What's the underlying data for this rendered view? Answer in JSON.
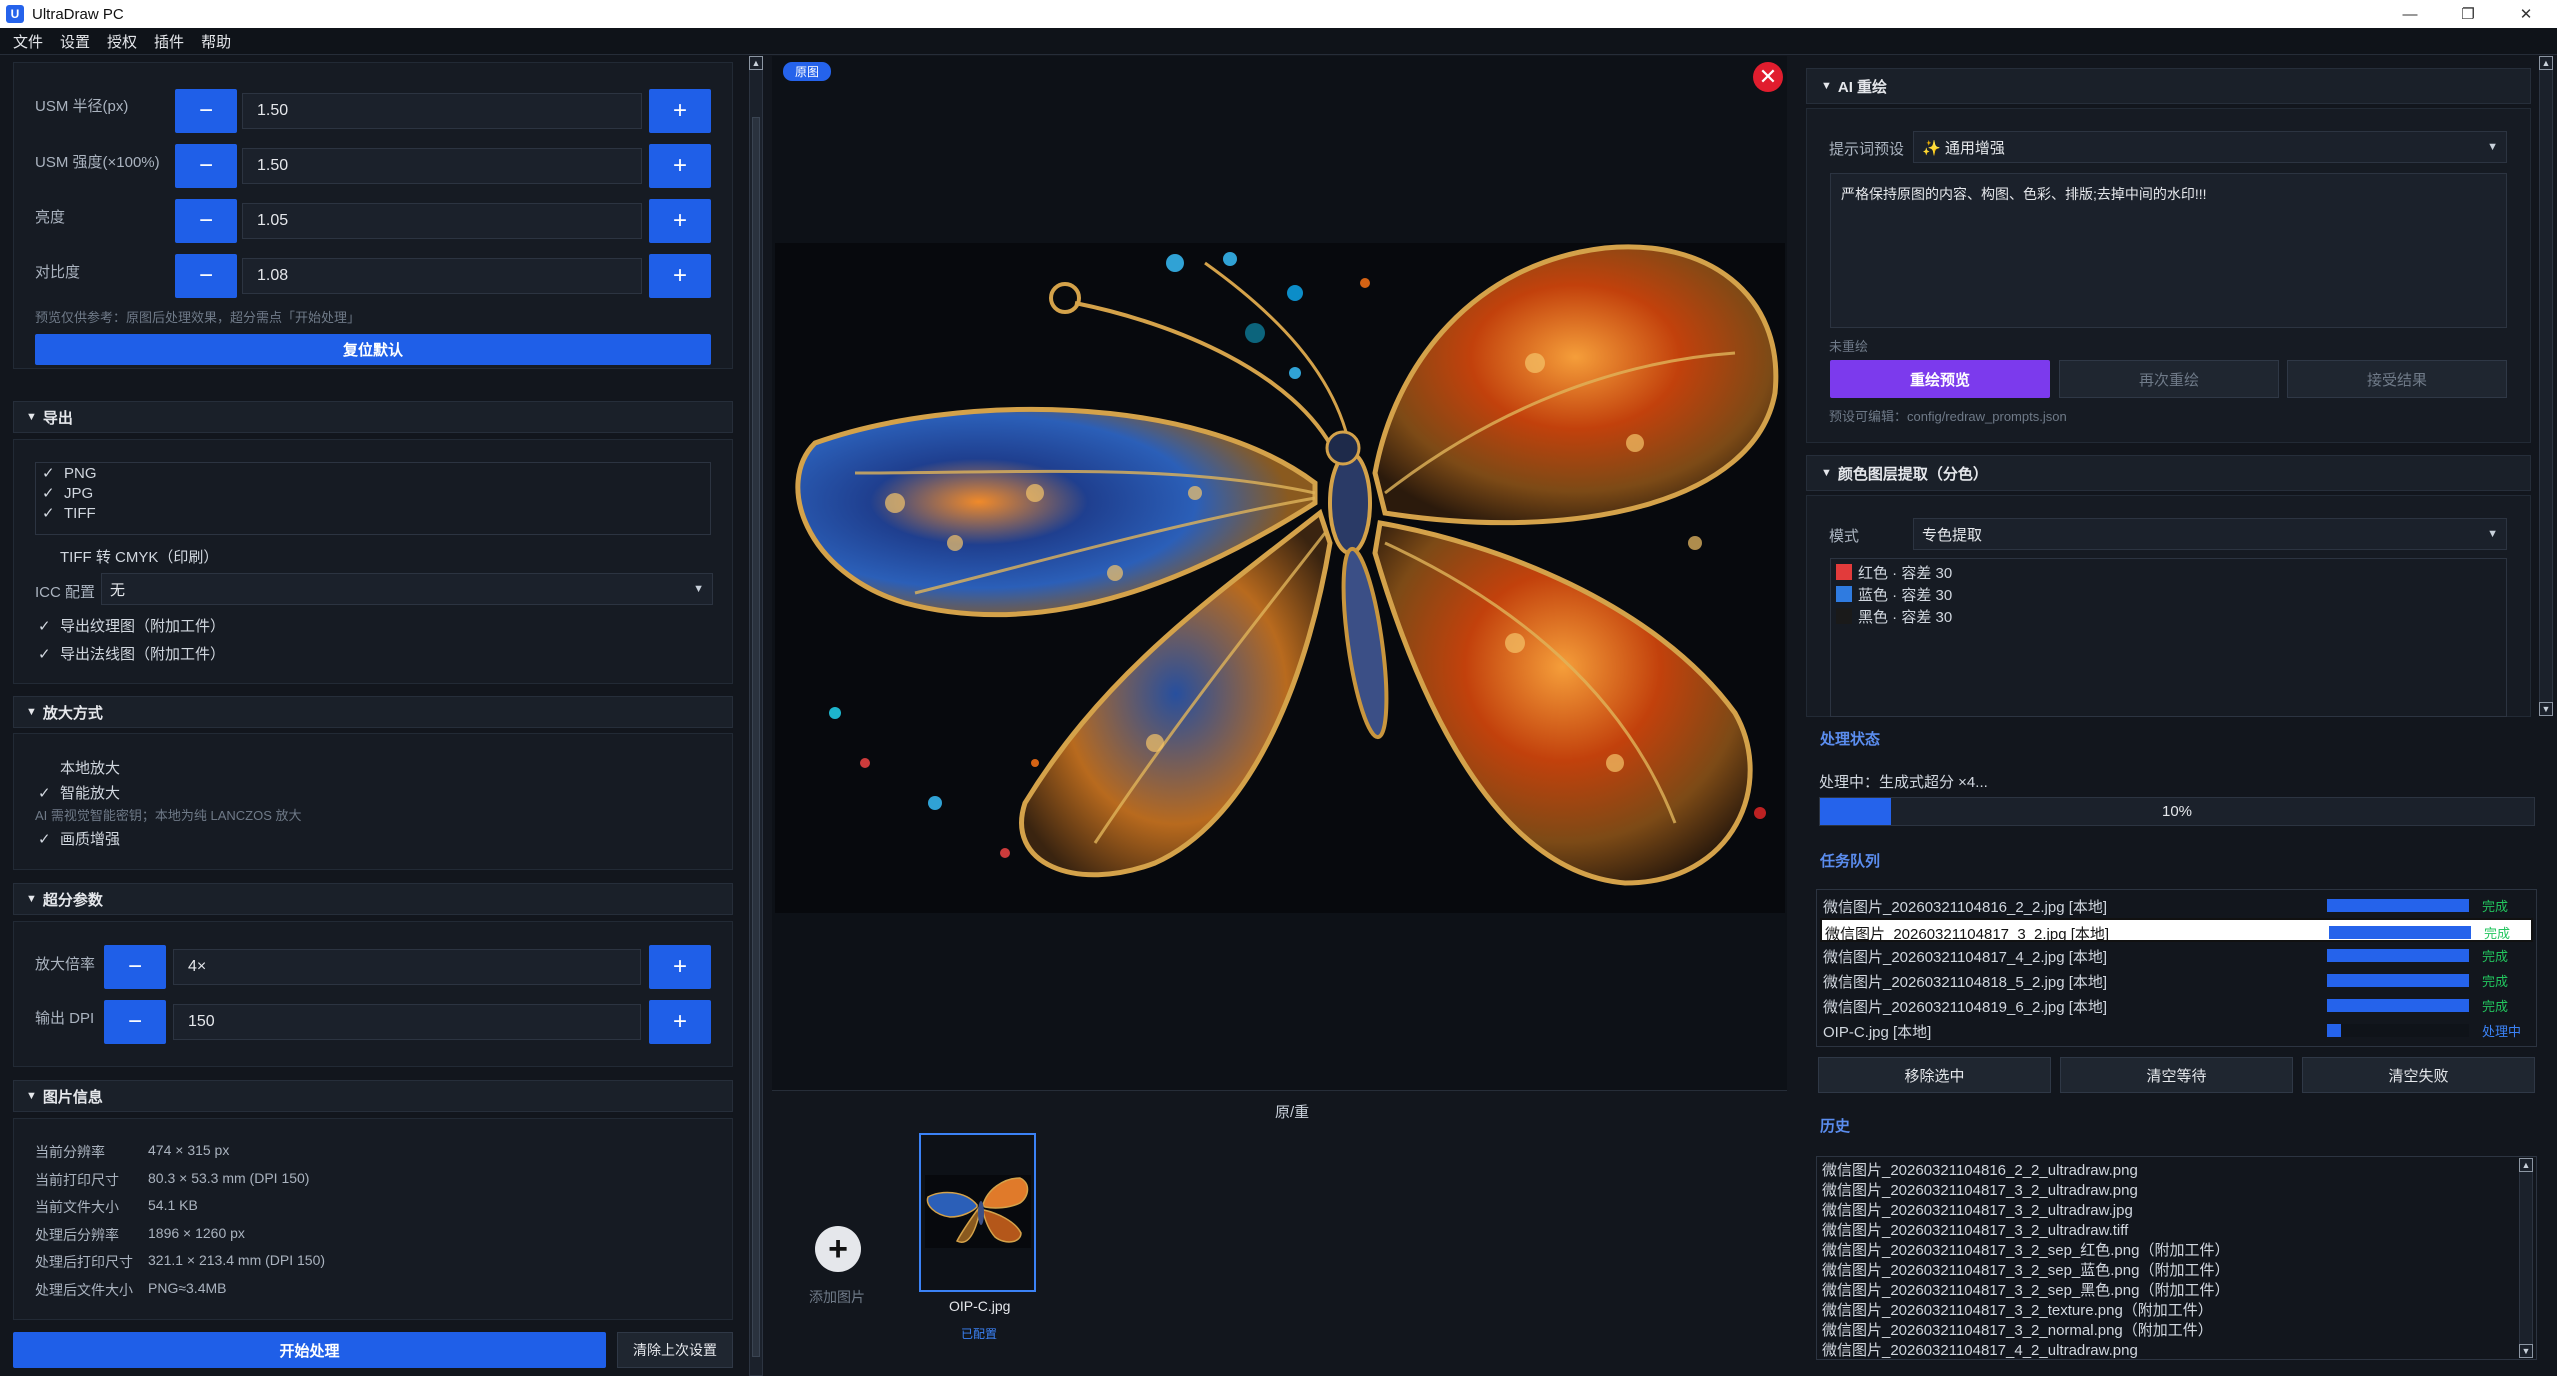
{
  "window": {
    "app_icon": "U",
    "title": "UltraDraw PC",
    "controls": [
      "—",
      "❐",
      "✕"
    ]
  },
  "menu": [
    "文件",
    "设置",
    "授权",
    "插件",
    "帮助"
  ],
  "adjust": {
    "usm_radius": {
      "label": "USM 半径(px)",
      "value": "1.50"
    },
    "usm_strength": {
      "label": "USM 强度(×100%)",
      "value": "1.50"
    },
    "brightness": {
      "label": "亮度",
      "value": "1.05"
    },
    "contrast": {
      "label": "对比度",
      "value": "1.08"
    },
    "minus": "−",
    "plus": "+",
    "note": "预览仅供参考：原图后处理效果，超分需点「开始处理」",
    "reset_label": "复位默认"
  },
  "export": {
    "title": "导出",
    "formats": [
      {
        "check": "✓",
        "label": "PNG"
      },
      {
        "check": "✓",
        "label": "JPG"
      },
      {
        "check": "✓",
        "label": "TIFF"
      }
    ],
    "cmyk": {
      "check": "",
      "label": "TIFF 转 CMYK（印刷）"
    },
    "icc_label": "ICC 配置",
    "icc_value": "无",
    "texture": {
      "check": "✓",
      "label": "导出纹理图（附加工件）"
    },
    "normal": {
      "check": "✓",
      "label": "导出法线图（附加工件）"
    }
  },
  "upscale_mode": {
    "title": "放大方式",
    "local": {
      "check": "",
      "label": "本地放大"
    },
    "smart": {
      "check": "✓",
      "label": "智能放大"
    },
    "note": "AI 需视觉智能密钥；本地为纯 LANCZOS 放大",
    "enhance": {
      "check": "✓",
      "label": "画质增强"
    }
  },
  "sr_params": {
    "title": "超分参数",
    "scale": {
      "label": "放大倍率",
      "value": "4×"
    },
    "dpi": {
      "label": "输出 DPI",
      "value": "150"
    }
  },
  "image_info": {
    "title": "图片信息",
    "rows": [
      {
        "label": "当前分辨率",
        "value": "474 × 315 px"
      },
      {
        "label": "当前打印尺寸",
        "value": "80.3 × 53.3 mm (DPI 150)"
      },
      {
        "label": "当前文件大小",
        "value": "54.1 KB"
      },
      {
        "label": "处理后分辨率",
        "value": "1896 × 1260 px"
      },
      {
        "label": "处理后打印尺寸",
        "value": "321.1 × 213.4 mm (DPI 150)"
      },
      {
        "label": "处理后文件大小",
        "value": "PNG≈3.4MB"
      }
    ]
  },
  "bottom": {
    "start_label": "开始处理",
    "clear_label": "清除上次设置"
  },
  "canvas": {
    "tag": "原图",
    "close": "✕",
    "compare_label": "原/重",
    "add_label": "添加图片",
    "add_icon": "+",
    "thumb_name": "OIP-C.jpg",
    "thumb_status": "已配置"
  },
  "ai_redraw": {
    "title": "AI 重绘",
    "preset_label": "提示词预设",
    "preset_value": "✨ 通用增强",
    "prompt": "严格保持原图的内容、构图、色彩、排版;去掉中间的水印!!!",
    "state": "未重绘",
    "preview_btn": "重绘预览",
    "again_btn": "再次重绘",
    "accept_btn": "接受结果",
    "config_note": "预设可编辑：config/redraw_prompts.json"
  },
  "color_layers": {
    "title": "颜色图层提取（分色）",
    "mode_label": "模式",
    "mode_value": "专色提取",
    "items": [
      {
        "color": "#e23b3b",
        "label": "红色 · 容差 30"
      },
      {
        "color": "#2f7be0",
        "label": "蓝色 · 容差 30"
      },
      {
        "color": "#1a1a1a",
        "label": "黑色 · 容差 30"
      }
    ]
  },
  "status": {
    "title": "处理状态",
    "text": "处理中：生成式超分 ×4...",
    "progress_label": "10%",
    "progress": 0.1
  },
  "queue": {
    "title": "任务队列",
    "items": [
      {
        "name": "微信图片_20260321104816_2_2.jpg  [本地]",
        "progress": 1.0,
        "status": "完成"
      },
      {
        "name": "微信图片_20260321104817_3_2.jpg  [本地]",
        "progress": 1.0,
        "status": "完成"
      },
      {
        "name": "微信图片_20260321104817_4_2.jpg  [本地]",
        "progress": 1.0,
        "status": "完成"
      },
      {
        "name": "微信图片_20260321104818_5_2.jpg  [本地]",
        "progress": 1.0,
        "status": "完成"
      },
      {
        "name": "微信图片_20260321104819_6_2.jpg  [本地]",
        "progress": 1.0,
        "status": "完成"
      },
      {
        "name": "OIP-C.jpg  [本地]",
        "progress": 0.1,
        "status": "处理中"
      }
    ],
    "remove_btn": "移除选中",
    "clear_wait_btn": "清空等待",
    "clear_fail_btn": "清空失败"
  },
  "history": {
    "title": "历史",
    "items": [
      "微信图片_20260321104816_2_2_ultradraw.png",
      "微信图片_20260321104817_3_2_ultradraw.png",
      "微信图片_20260321104817_3_2_ultradraw.jpg",
      "微信图片_20260321104817_3_2_ultradraw.tiff",
      "微信图片_20260321104817_3_2_sep_红色.png（附加工件）",
      "微信图片_20260321104817_3_2_sep_蓝色.png（附加工件）",
      "微信图片_20260321104817_3_2_sep_黑色.png（附加工件）",
      "微信图片_20260321104817_3_2_texture.png（附加工件）",
      "微信图片_20260321104817_3_2_normal.png（附加工件）",
      "微信图片_20260321104817_4_2_ultradraw.png"
    ]
  },
  "colors": {
    "accent": "#1f5fe8",
    "purple": "#7c3aed",
    "success": "#22c55e",
    "processing": "#3b82f6"
  }
}
